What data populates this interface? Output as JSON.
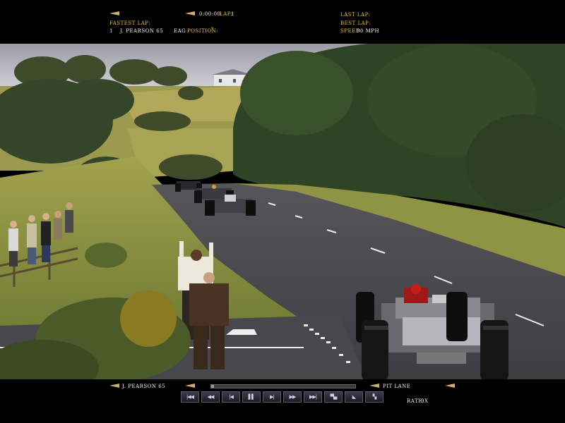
{
  "hud_top": {
    "time": "0:00:00",
    "lap_label": "Lap:",
    "lap_value": "1",
    "fastest_lap_label": "Fastest Lap:",
    "fastest_lap_number": "1",
    "fastest_lap_driver": "J. Pearson 65",
    "fastest_lap_team": "EAG",
    "position_label": "Position:",
    "position_value": "\"",
    "last_lap_label": "Last Lap:",
    "best_lap_label": "Best Lap:",
    "speed_label": "Speed:",
    "speed_value": "90 mph"
  },
  "hud_bottom": {
    "driver": "J. Pearson 65",
    "location": "Pit Lane",
    "rate_label": "Rate:",
    "rate_value": "0x",
    "progress_fraction": 0.02,
    "controls": [
      {
        "icon": "skip-to-start-icon",
        "glyph": "|◀◀"
      },
      {
        "icon": "fast-rewind-icon",
        "glyph": "◀◀"
      },
      {
        "icon": "step-back-icon",
        "glyph": "|◀"
      },
      {
        "icon": "pause-icon",
        "glyph": "▌▌"
      },
      {
        "icon": "step-forward-icon",
        "glyph": "▶|"
      },
      {
        "icon": "fast-forward-icon",
        "glyph": "▶▶"
      },
      {
        "icon": "skip-to-end-icon",
        "glyph": "▶▶|"
      },
      {
        "icon": "camera-icon",
        "glyph": "▀▄"
      },
      {
        "icon": "view-icon",
        "glyph": "◣"
      },
      {
        "icon": "options-icon",
        "glyph": "▚"
      }
    ]
  },
  "colors": {
    "hud_yellow": "#e8c24a",
    "hud_white": "#f2f2f2",
    "asphalt": "#4a4a4f",
    "grass": "#9a9a4a"
  }
}
